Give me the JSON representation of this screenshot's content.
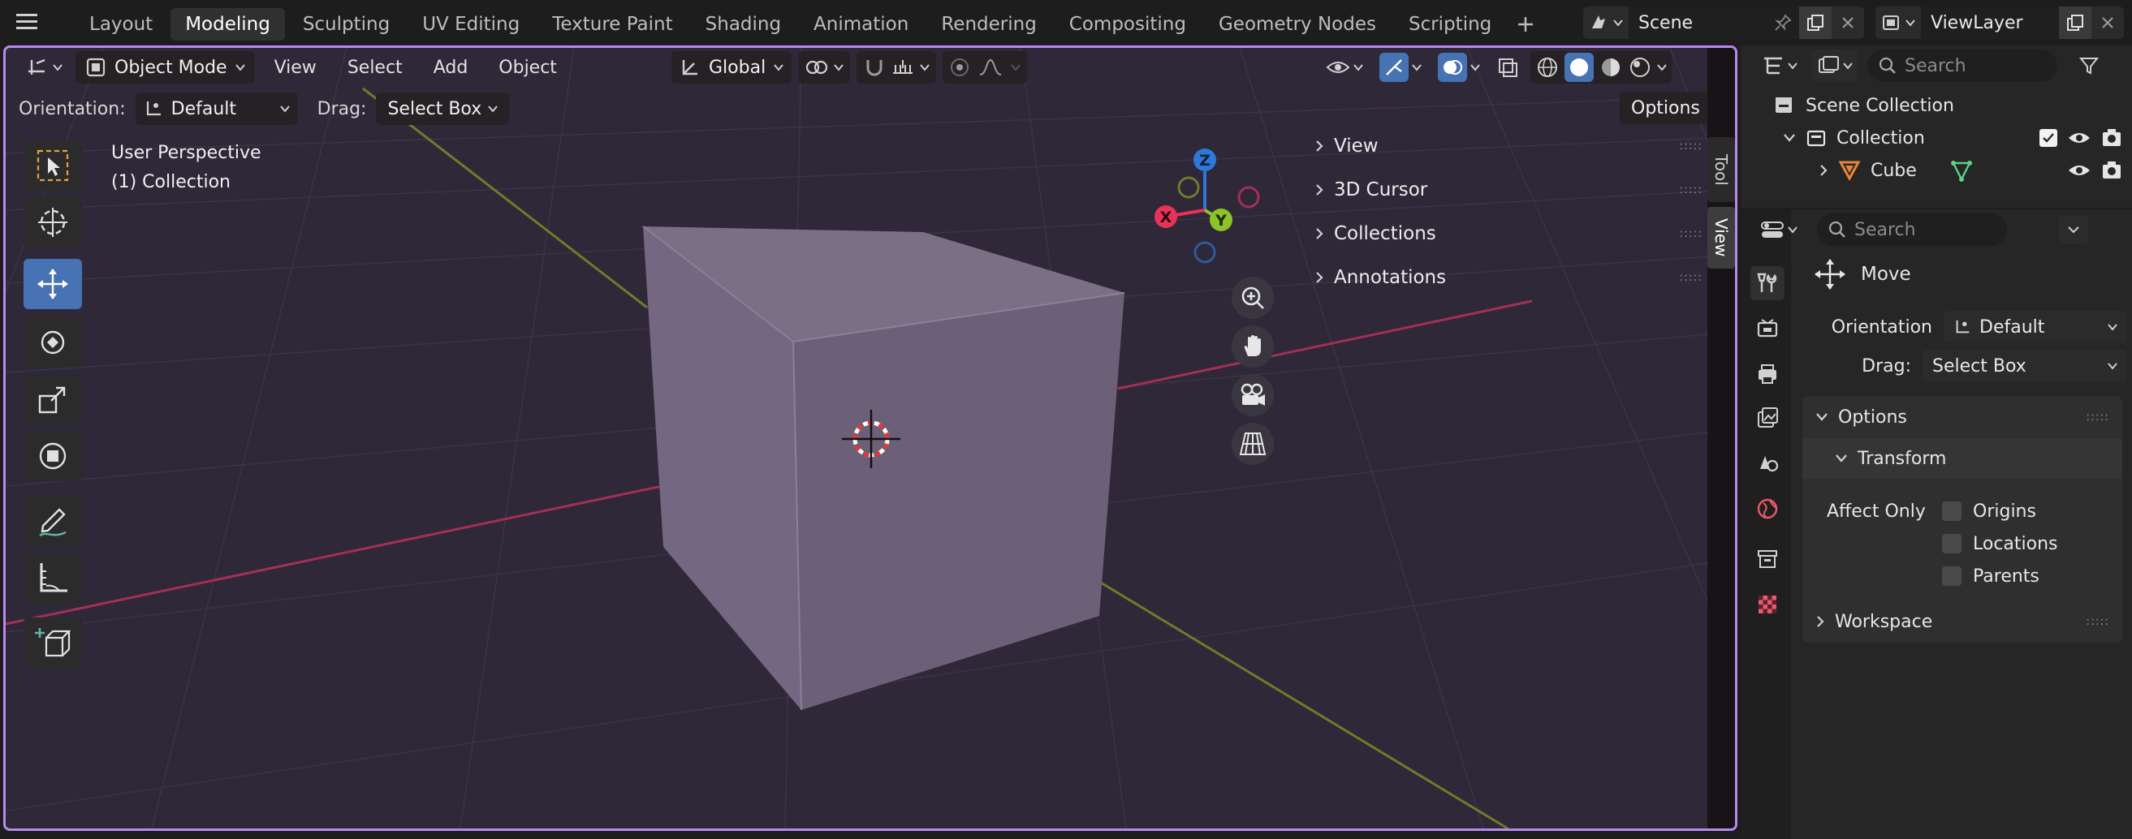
{
  "workspaces": [
    "Layout",
    "Modeling",
    "Sculpting",
    "UV Editing",
    "Texture Paint",
    "Shading",
    "Animation",
    "Rendering",
    "Compositing",
    "Geometry Nodes",
    "Scripting"
  ],
  "active_workspace": "Modeling",
  "scene": {
    "name": "Scene"
  },
  "view_layer": {
    "name": "ViewLayer"
  },
  "header": {
    "mode": "Object Mode",
    "menus": [
      "View",
      "Select",
      "Add",
      "Object"
    ],
    "transform_orientation": "Global"
  },
  "tool_settings": {
    "orientation_label": "Orientation:",
    "orientation_value": "Default",
    "drag_label": "Drag:",
    "drag_value": "Select Box",
    "options_label": "Options"
  },
  "viewport": {
    "perspective": "User Perspective",
    "collection": "(1) Collection"
  },
  "gizmo": {
    "z": "Z",
    "x": "X",
    "y": "Y"
  },
  "npanel": {
    "sections": [
      "View",
      "3D Cursor",
      "Collections",
      "Annotations"
    ],
    "tabs": [
      "Tool",
      "View"
    ]
  },
  "outliner": {
    "search_placeholder": "Search",
    "scene_collection": "Scene Collection",
    "collection": "Collection",
    "object": "Cube"
  },
  "properties": {
    "search_placeholder": "Search",
    "tool_name": "Move",
    "orientation_label": "Orientation",
    "orientation_value": "Default",
    "drag_label": "Drag:",
    "drag_value": "Select Box",
    "options_header": "Options",
    "transform_header": "Transform",
    "affect_only_label": "Affect Only",
    "affect_options": [
      "Origins",
      "Locations",
      "Parents"
    ],
    "workspace_header": "Workspace"
  },
  "colors": {
    "accent": "#4772b3",
    "viewport_border": "#b889f0",
    "viewport_bg": "#2f2838",
    "axis_x": "#e8325a",
    "axis_y": "#8bc428",
    "axis_z": "#2e78d8"
  }
}
